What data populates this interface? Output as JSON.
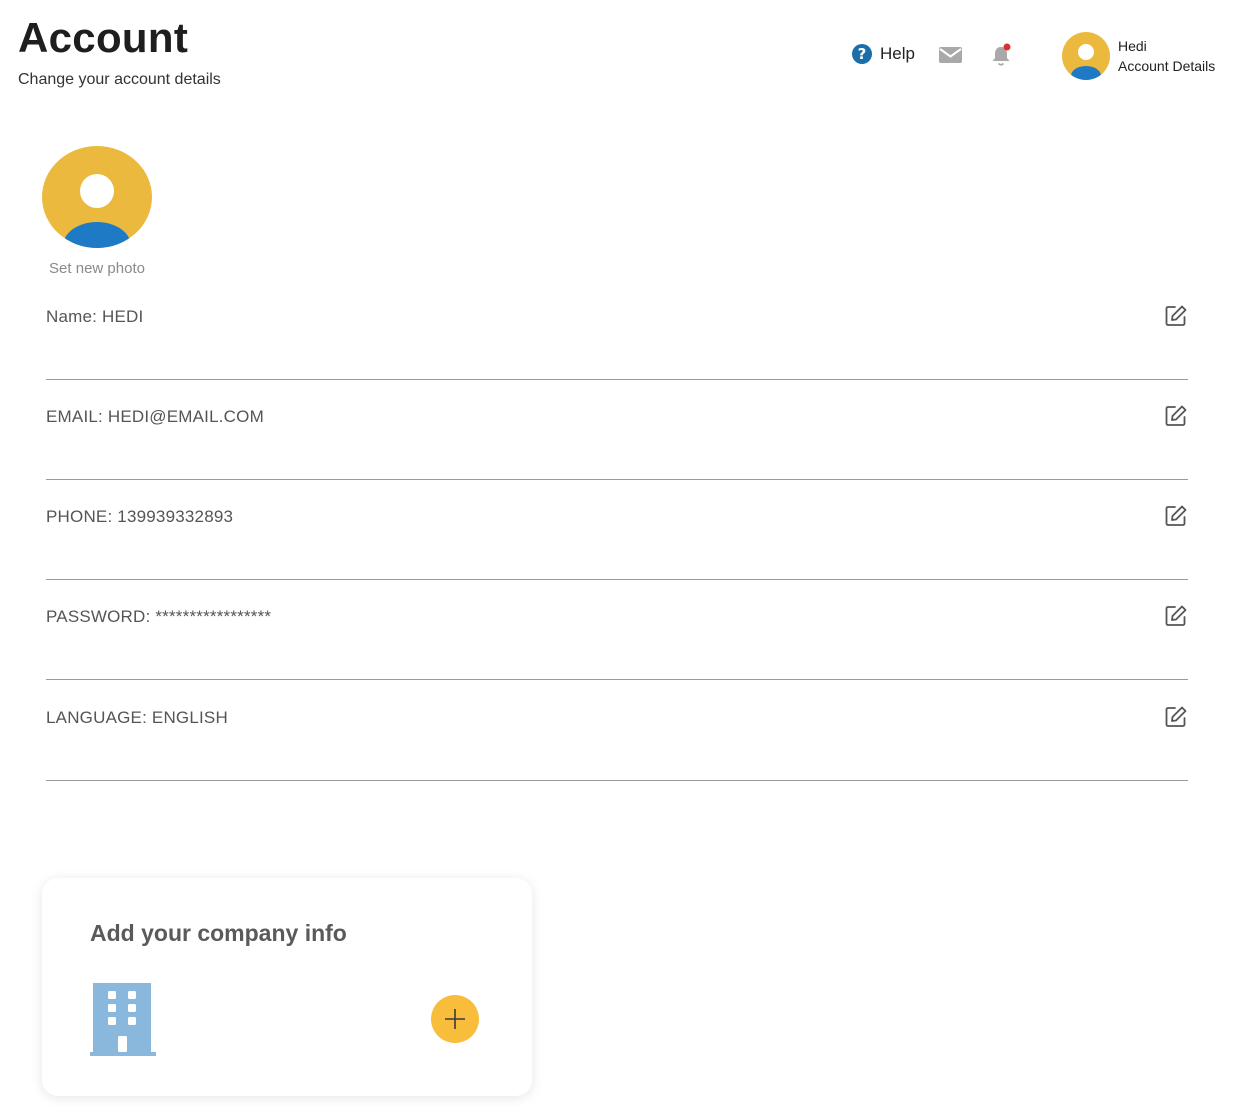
{
  "header": {
    "title": "Account",
    "subtitle": "Change your account details",
    "help_label": "Help",
    "user_name": "Hedi",
    "user_link": "Account Details"
  },
  "profile": {
    "set_photo_label": "Set new photo"
  },
  "fields": [
    {
      "text": "Name: HEDI"
    },
    {
      "text": "EMAIL: HEDI@EMAIL.COM"
    },
    {
      "text": "PHONE: 139939332893"
    },
    {
      "text": "PASSWORD: *****************"
    },
    {
      "text": "LANGUAGE: ENGLISH"
    }
  ],
  "company_card": {
    "title": "Add your company info"
  },
  "icons": {
    "help": "help-circle-icon",
    "mail": "mail-icon",
    "bell": "bell-icon",
    "edit": "edit-pencil-icon",
    "building": "building-icon",
    "add": "plus-icon"
  },
  "colors": {
    "avatar_bg": "#ebb93d",
    "avatar_body": "#1e7ac4",
    "help_blue": "#1a6fa8",
    "notification_dot": "#d9322e",
    "add_button": "#f8bd3b",
    "building": "#8ab8dc"
  }
}
